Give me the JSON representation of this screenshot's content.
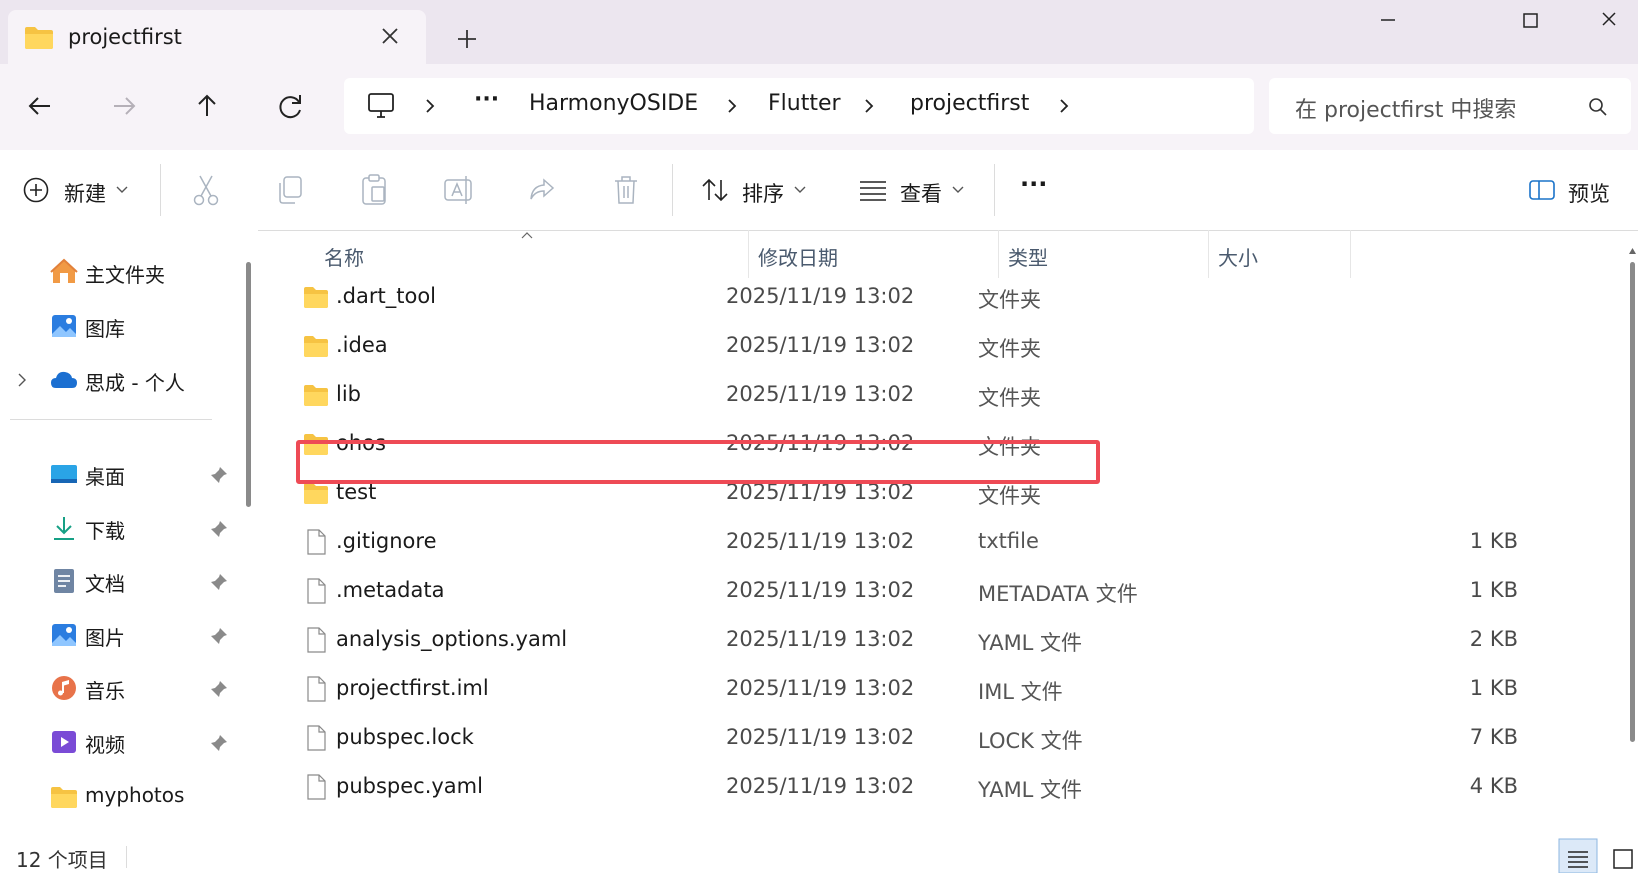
{
  "window": {
    "tab_title": "projectfirst",
    "colors": {
      "titlebar_bg": "#ece6ef",
      "highlight_border": "#ee4a55",
      "folder": "#f6c343",
      "accent": "#1a73c9"
    }
  },
  "nav": {
    "breadcrumbs": [
      "HarmonyOSIDE",
      "Flutter",
      "projectfirst"
    ],
    "overflow_label": "···",
    "search_placeholder": "在 projectfirst 中搜索"
  },
  "toolbar": {
    "new_label": "新建",
    "sort_label": "排序",
    "view_label": "查看",
    "more_label": "···",
    "preview_label": "预览"
  },
  "sidebar": {
    "top_items": [
      {
        "label": "主文件夹",
        "icon": "home-icon"
      },
      {
        "label": "图库",
        "icon": "gallery-icon"
      },
      {
        "label": "思成 - 个人",
        "icon": "cloud-icon"
      }
    ],
    "quick_access": [
      {
        "label": "桌面",
        "icon": "desktop-icon"
      },
      {
        "label": "下载",
        "icon": "download-icon"
      },
      {
        "label": "文档",
        "icon": "documents-icon"
      },
      {
        "label": "图片",
        "icon": "pictures-icon"
      },
      {
        "label": "音乐",
        "icon": "music-icon"
      },
      {
        "label": "视频",
        "icon": "videos-icon"
      },
      {
        "label": "myphotos",
        "icon": "folder-icon"
      }
    ]
  },
  "files": {
    "columns": [
      "名称",
      "修改日期",
      "类型",
      "大小"
    ],
    "rows": [
      {
        "name": ".dart_tool",
        "date": "2025/11/19 13:02",
        "type": "文件夹",
        "size": "",
        "kind": "folder"
      },
      {
        "name": ".idea",
        "date": "2025/11/19 13:02",
        "type": "文件夹",
        "size": "",
        "kind": "folder"
      },
      {
        "name": "lib",
        "date": "2025/11/19 13:02",
        "type": "文件夹",
        "size": "",
        "kind": "folder"
      },
      {
        "name": "ohos",
        "date": "2025/11/19 13:02",
        "type": "文件夹",
        "size": "",
        "kind": "folder"
      },
      {
        "name": "test",
        "date": "2025/11/19 13:02",
        "type": "文件夹",
        "size": "",
        "kind": "folder"
      },
      {
        "name": ".gitignore",
        "date": "2025/11/19 13:02",
        "type": "txtfile",
        "size": "1 KB",
        "kind": "file"
      },
      {
        "name": ".metadata",
        "date": "2025/11/19 13:02",
        "type": "METADATA 文件",
        "size": "1 KB",
        "kind": "file"
      },
      {
        "name": "analysis_options.yaml",
        "date": "2025/11/19 13:02",
        "type": "YAML 文件",
        "size": "2 KB",
        "kind": "file"
      },
      {
        "name": "projectfirst.iml",
        "date": "2025/11/19 13:02",
        "type": "IML 文件",
        "size": "1 KB",
        "kind": "file"
      },
      {
        "name": "pubspec.lock",
        "date": "2025/11/19 13:02",
        "type": "LOCK 文件",
        "size": "7 KB",
        "kind": "file"
      },
      {
        "name": "pubspec.yaml",
        "date": "2025/11/19 13:02",
        "type": "YAML 文件",
        "size": "4 KB",
        "kind": "file"
      }
    ]
  },
  "status": {
    "item_count": "12 个项目"
  }
}
